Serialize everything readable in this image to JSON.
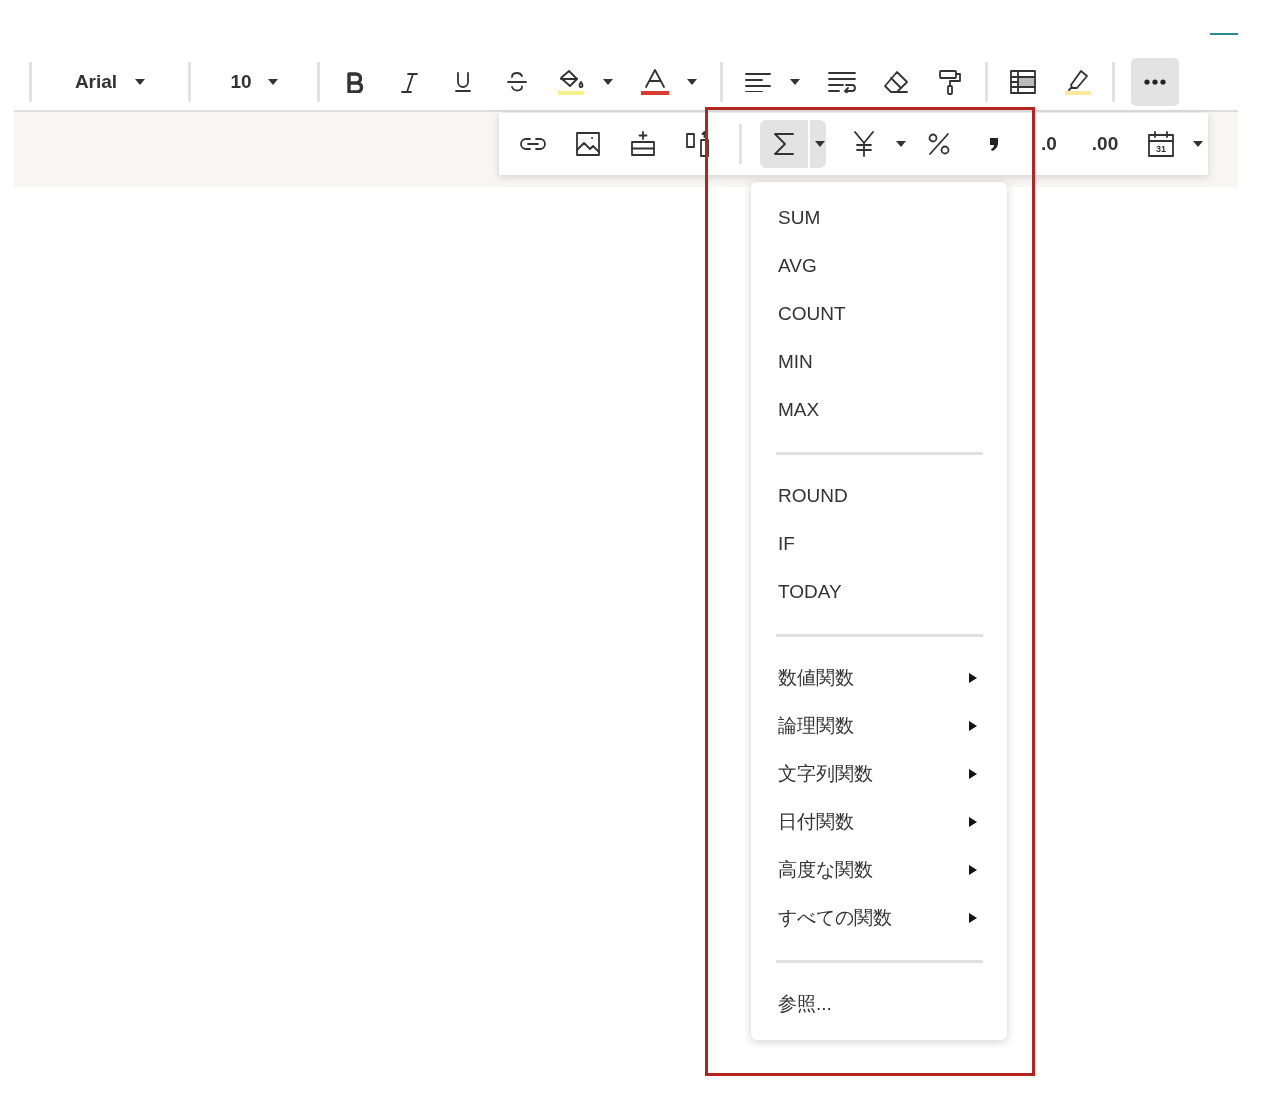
{
  "toolbar": {
    "font": "Arial",
    "font_size": "10",
    "more_selected": true
  },
  "format_toolbar": {
    "sum_selected": true,
    "decrease_decimal": ".0",
    "increase_decimal": ".00",
    "calendar_day": "31"
  },
  "function_menu": {
    "groups": [
      [
        {
          "label": "SUM",
          "submenu": false
        },
        {
          "label": "AVG",
          "submenu": false
        },
        {
          "label": "COUNT",
          "submenu": false
        },
        {
          "label": "MIN",
          "submenu": false
        },
        {
          "label": "MAX",
          "submenu": false
        }
      ],
      [
        {
          "label": "ROUND",
          "submenu": false
        },
        {
          "label": "IF",
          "submenu": false
        },
        {
          "label": "TODAY",
          "submenu": false
        }
      ],
      [
        {
          "label": "数値関数",
          "submenu": true
        },
        {
          "label": "論理関数",
          "submenu": true
        },
        {
          "label": "文字列関数",
          "submenu": true
        },
        {
          "label": "日付関数",
          "submenu": true
        },
        {
          "label": "高度な関数",
          "submenu": true
        },
        {
          "label": "すべての関数",
          "submenu": true
        }
      ],
      [
        {
          "label": "参照...",
          "submenu": false
        }
      ]
    ]
  }
}
